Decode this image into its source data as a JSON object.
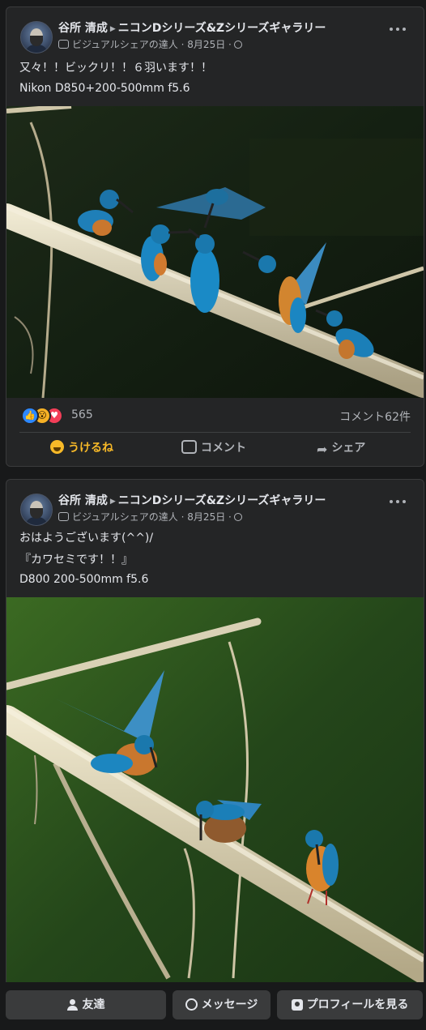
{
  "posts": [
    {
      "author": "谷所 清成",
      "group": "ニコンDシリーズ&Zシリーズギャラリー",
      "badge": "ビジュアルシェアの達人",
      "date": "8月25日",
      "lines": [
        "又々！！ビックリ！！６羽います！！",
        "Nikon D850+200-500mm f5.6"
      ],
      "photo_alt": "kingfishers-on-bamboo",
      "reaction_icons": [
        "like-icon",
        "wow-icon",
        "love-icon"
      ],
      "reaction_count": "565",
      "comment_count": "コメント62件",
      "actions": {
        "like": "うけるね",
        "comment": "コメント",
        "share": "シェア"
      }
    },
    {
      "author": "谷所 清成",
      "group": "ニコンDシリーズ&Zシリーズギャラリー",
      "badge": "ビジュアルシェアの達人",
      "date": "8月25日",
      "lines": [
        "おはようございます(^^)/",
        "『カワセミです！！』",
        "D800 200-500mm f5.6"
      ],
      "photo_alt": "kingfishers-on-bamboo"
    }
  ],
  "separator": "·",
  "bottom_bar": {
    "friends": "友達",
    "message": "メッセージ",
    "profile": "プロフィールを見る"
  },
  "colors": {
    "background": "#18191a",
    "card": "#242526",
    "like_active": "#f7b928",
    "link_blue": "#2d88ff"
  }
}
